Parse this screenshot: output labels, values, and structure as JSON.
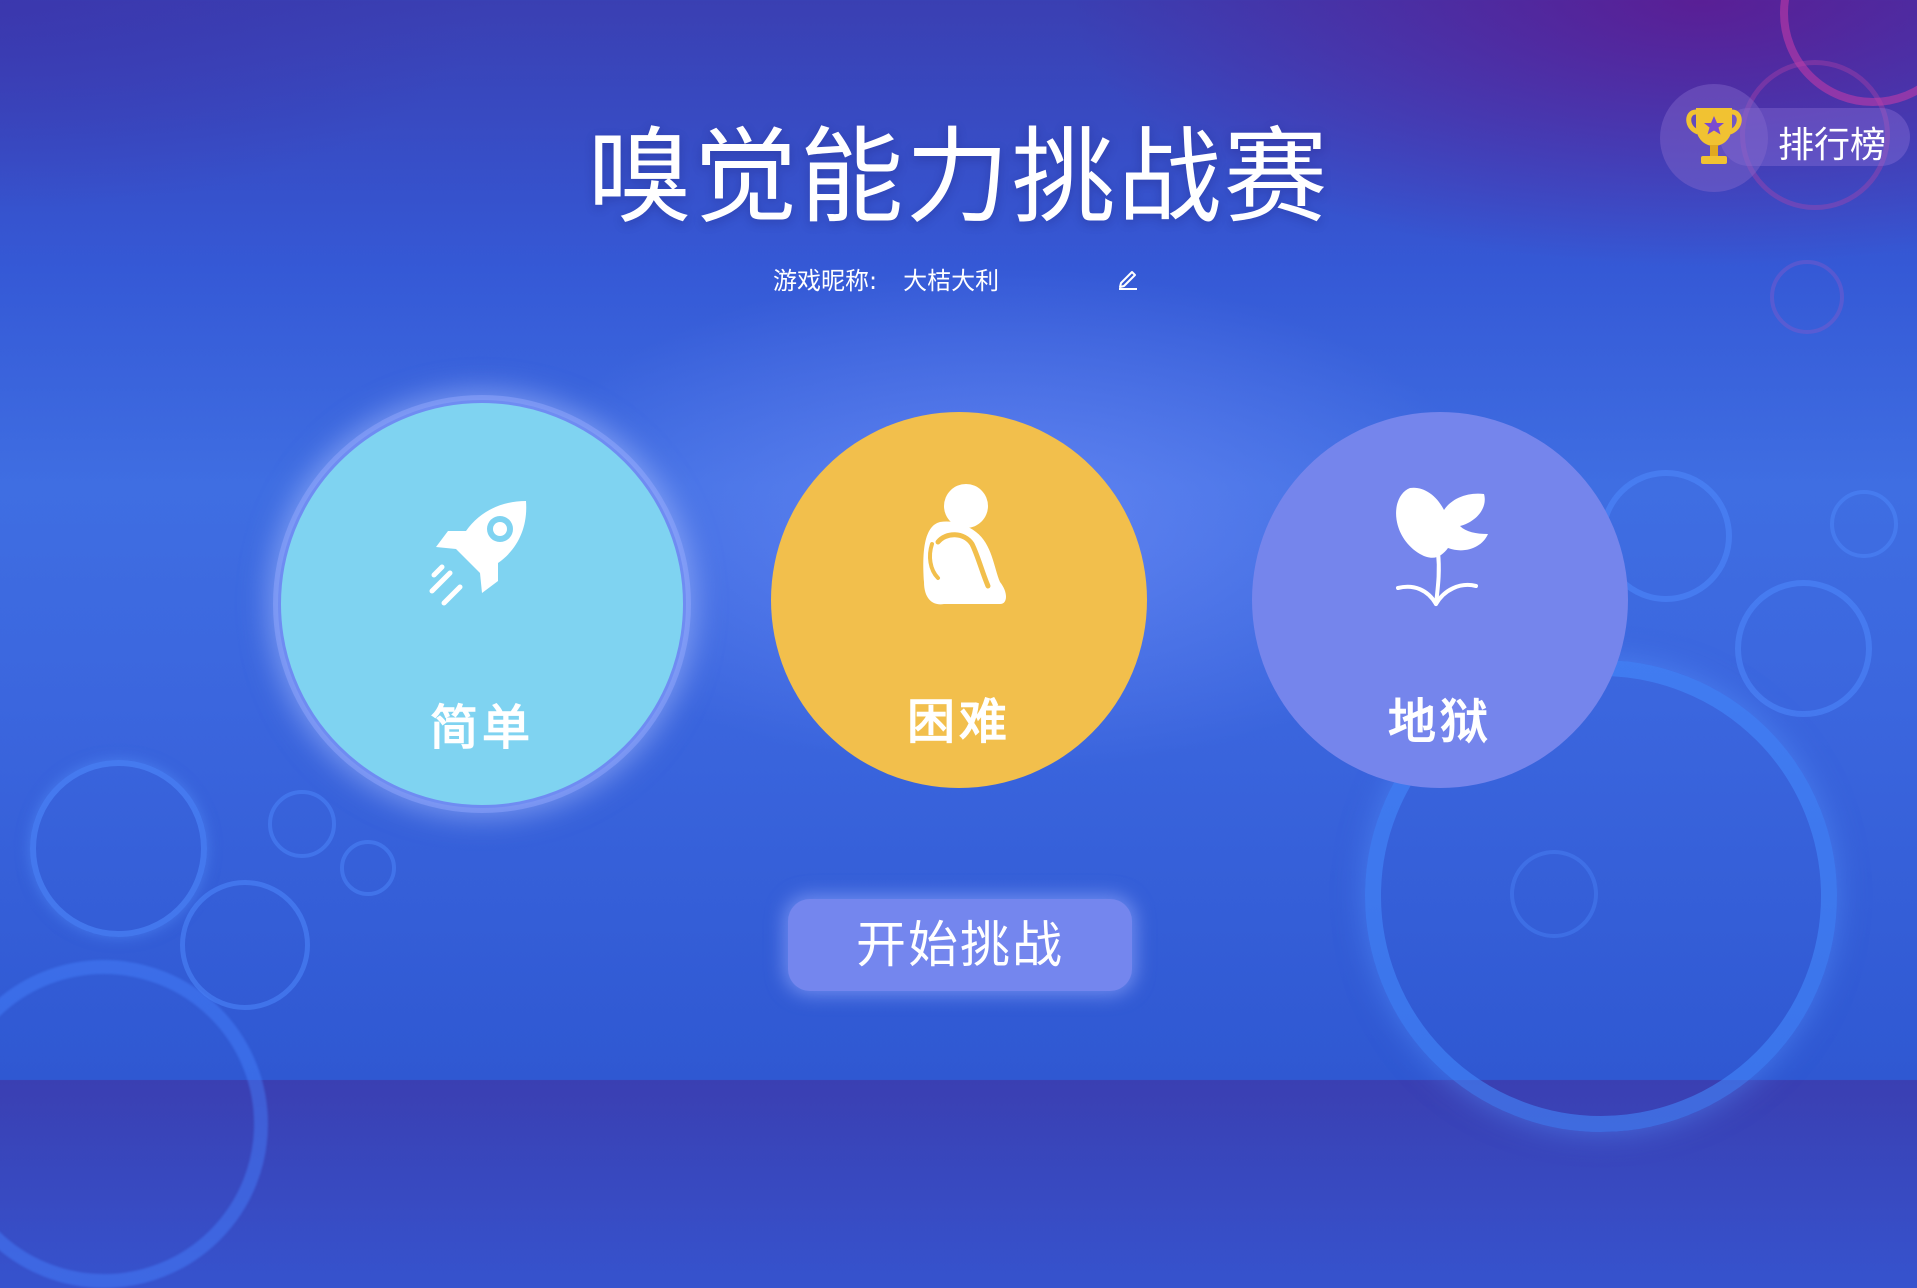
{
  "title": "嗅觉能力挑战赛",
  "nickname": {
    "label": "游戏昵称:",
    "value": "大桔大利"
  },
  "leaderboard": {
    "label": "排行榜",
    "icon": "trophy-icon"
  },
  "modes": [
    {
      "label": "简单",
      "icon": "rocket-icon",
      "color": "#7fd3f1",
      "selected": true
    },
    {
      "label": "困难",
      "icon": "sitting-person-icon",
      "color": "#f2bf4c",
      "selected": false
    },
    {
      "label": "地狱",
      "icon": "tulip-icon",
      "color": "#7585ec",
      "selected": false
    }
  ],
  "start_button": {
    "label": "开始挑战"
  },
  "colors": {
    "background": "#3559d6",
    "accent": "#7486ee",
    "trophy": "#f1c232"
  }
}
